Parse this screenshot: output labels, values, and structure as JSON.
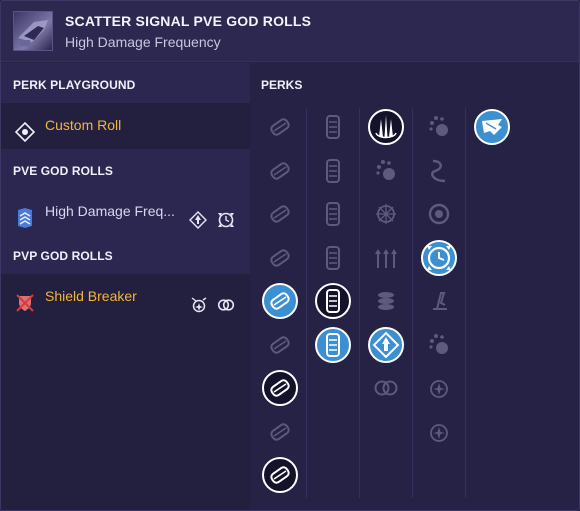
{
  "header": {
    "title": "SCATTER SIGNAL PVE GOD ROLLS",
    "subtitle": "High Damage Frequency",
    "weapon_icon": "scatter-signal-weapon-icon"
  },
  "left_panel": {
    "sections": [
      {
        "title": "PERK PLAYGROUND",
        "items": [
          {
            "label": "Custom Roll",
            "icon": "target-icon",
            "color": "#f3b53a",
            "selected": false,
            "mini_icons": []
          }
        ]
      },
      {
        "title": "PVE GOD ROLLS",
        "items": [
          {
            "label": "High Damage Freq...",
            "icon": "chevron-stack-icon",
            "color": "#d9d6ee",
            "selected": true,
            "mini_icons": [
              "diamond-arrow-icon",
              "clock-reload-icon"
            ]
          }
        ]
      },
      {
        "title": "PVP GOD ROLLS",
        "items": [
          {
            "label": "Shield Breaker",
            "icon": "crossed-shield-icon",
            "color": "#f3b53a",
            "selected": false,
            "mini_icons": [
              "burst-icon",
              "rings-icon"
            ]
          }
        ]
      }
    ]
  },
  "perks": {
    "title": "PERKS",
    "colors": {
      "active_blue": "#3c8fd0",
      "active_dark": "#14112a",
      "dim": "#8c88b0"
    },
    "columns": [
      [
        {
          "icon": "barrel-slash-icon",
          "state": "dim"
        },
        {
          "icon": "barrel-corkscrew-icon",
          "state": "dim"
        },
        {
          "icon": "barrel-fluted-icon",
          "state": "dim"
        },
        {
          "icon": "barrel-cross-icon",
          "state": "dim"
        },
        {
          "icon": "barrel-spiral-icon",
          "state": "active-blue"
        },
        {
          "icon": "barrel-chambered-icon",
          "state": "dim"
        },
        {
          "icon": "barrel-extended-icon",
          "state": "active-dark"
        },
        {
          "icon": "barrel-rifled-icon",
          "state": "dim"
        },
        {
          "icon": "barrel-smallbore-icon",
          "state": "active-dark"
        }
      ],
      [
        {
          "icon": "mag-tactical-icon",
          "state": "dim"
        },
        {
          "icon": "mag-appended-icon",
          "state": "dim"
        },
        {
          "icon": "mag-flared-icon",
          "state": "dim"
        },
        {
          "icon": "mag-ricochet-icon",
          "state": "dim"
        },
        {
          "icon": "mag-extended-icon",
          "state": "active-dark"
        },
        {
          "icon": "mag-accurized-icon",
          "state": "active-blue"
        }
      ],
      [
        {
          "icon": "triple-spike-icon",
          "state": "active-dark"
        },
        {
          "icon": "reload-hand-icon",
          "state": "dim"
        },
        {
          "icon": "crosshair-star-icon",
          "state": "dim"
        },
        {
          "icon": "triple-arrow-up-icon",
          "state": "dim"
        },
        {
          "icon": "coin-stack-icon",
          "state": "dim"
        },
        {
          "icon": "diamond-arrow-icon",
          "state": "active-blue"
        },
        {
          "icon": "rings-icon",
          "state": "dim"
        }
      ],
      [
        {
          "icon": "splash-fist-icon",
          "state": "dim"
        },
        {
          "icon": "swirl-icon",
          "state": "dim"
        },
        {
          "icon": "target-ring-icon",
          "state": "dim"
        },
        {
          "icon": "clock-reload-icon",
          "state": "active-blue"
        },
        {
          "icon": "trigger-icon",
          "state": "dim"
        },
        {
          "icon": "splash-fist-alt-icon",
          "state": "dim"
        },
        {
          "icon": "burst-icon",
          "state": "dim"
        },
        {
          "icon": "sparkle-burst-icon",
          "state": "dim"
        }
      ],
      [
        {
          "icon": "origin-wing-icon",
          "state": "active-blue"
        }
      ]
    ]
  }
}
